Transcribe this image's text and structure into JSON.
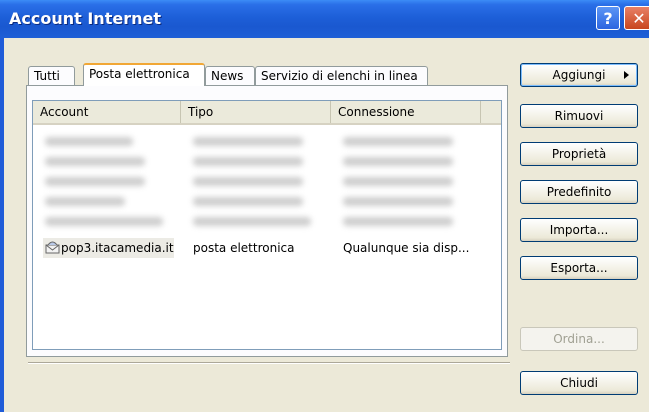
{
  "window": {
    "title": "Account Internet"
  },
  "tabs": [
    "Tutti",
    "Posta elettronica",
    "News",
    "Servizio di elenchi in linea"
  ],
  "list": {
    "columns": [
      "Account",
      "Tipo",
      "Connessione"
    ],
    "visible_row": {
      "account": "pop3.itacamedia.it",
      "tipo": "posta elettronica",
      "connessione": "Qualunque sia disp..."
    }
  },
  "buttons": {
    "aggiungi": "Aggiungi",
    "rimuovi": "Rimuovi",
    "proprieta": "Proprietà",
    "predefinito": "Predefinito",
    "importa": "Importa...",
    "esporta": "Esporta...",
    "ordina": "Ordina...",
    "chiudi": "Chiudi"
  },
  "icons": {
    "help": "help-icon",
    "close": "close-icon",
    "account": "mail-account-icon"
  }
}
